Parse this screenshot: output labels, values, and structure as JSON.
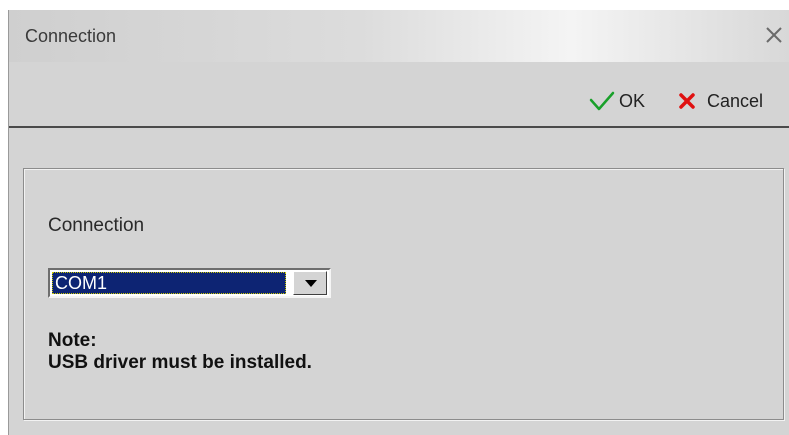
{
  "window": {
    "title": "Connection",
    "close_icon": "close-icon"
  },
  "toolbar": {
    "ok_label": "OK",
    "ok_icon": "checkmark-icon",
    "cancel_label": "Cancel",
    "cancel_icon": "cancel-x-icon"
  },
  "form": {
    "connection_label": "Connection",
    "connection_select": {
      "selected": "COM1"
    },
    "note_title": "Note:",
    "note_text": "USB driver must be installed."
  },
  "colors": {
    "dialog_background": "#d4d4d4",
    "selection_background": "#0d2473",
    "ok_green": "#19a02a",
    "cancel_red": "#e01010"
  }
}
